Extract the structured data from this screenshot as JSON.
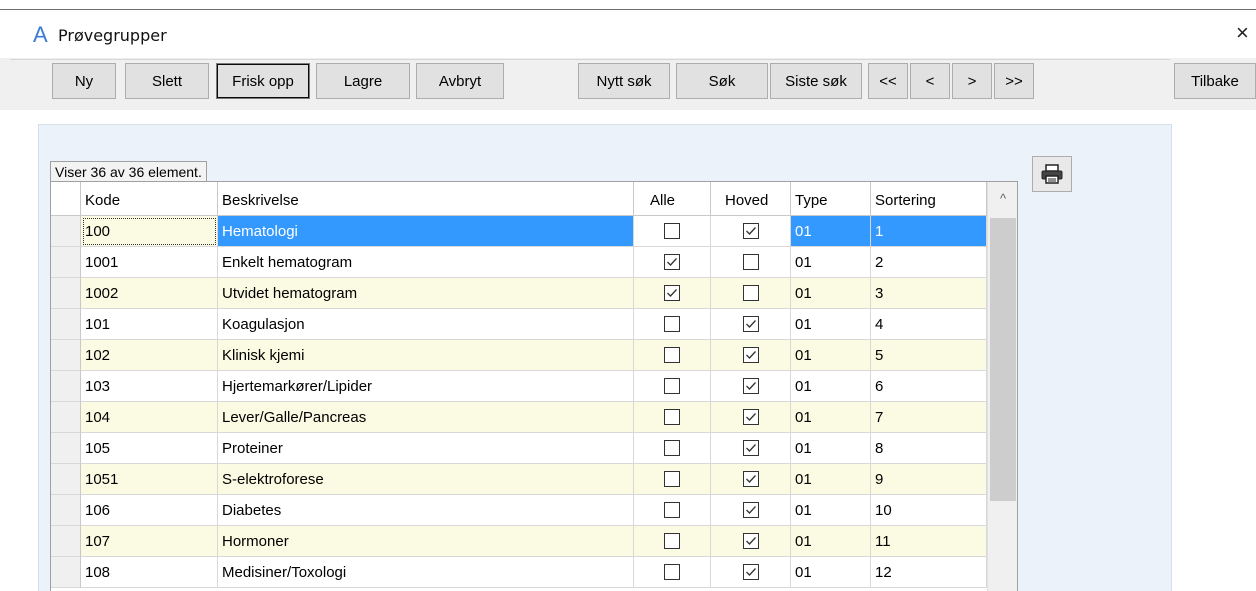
{
  "window": {
    "title": "Prøvegrupper",
    "logo": "A",
    "close": "×"
  },
  "toolbar": {
    "ny": "Ny",
    "slett": "Slett",
    "frisk_opp": "Frisk opp",
    "lagre": "Lagre",
    "avbryt": "Avbryt",
    "nytt_sok": "Nytt søk",
    "sok": "Søk",
    "siste_sok": "Siste søk",
    "first": "<<",
    "prev": "<",
    "next": ">",
    "last": ">>",
    "tilbake": "Tilbake"
  },
  "status": "Viser 36 av 36 element.",
  "icons": {
    "print": "printer-icon",
    "close": "close-icon",
    "scroll_up": "chevron-up-icon"
  },
  "colors": {
    "selection": "#3399ff",
    "alt_row": "#fbfbe3",
    "panel": "#ecf2f9",
    "logo": "#3d7bd1"
  },
  "table": {
    "columns": {
      "kode": "Kode",
      "beskrivelse": "Beskrivelse",
      "alle": "Alle",
      "hoved": "Hoved",
      "type": "Type",
      "sortering": "Sortering"
    },
    "scroll_up": "^",
    "rows": [
      {
        "kode": "100",
        "beskrivelse": "Hematologi",
        "alle": false,
        "hoved": true,
        "type": "01",
        "sortering": "1",
        "selected": true
      },
      {
        "kode": "1001",
        "beskrivelse": "Enkelt hematogram",
        "alle": true,
        "hoved": false,
        "type": "01",
        "sortering": "2"
      },
      {
        "kode": "1002",
        "beskrivelse": "Utvidet hematogram",
        "alle": true,
        "hoved": false,
        "type": "01",
        "sortering": "3"
      },
      {
        "kode": "101",
        "beskrivelse": "Koagulasjon",
        "alle": false,
        "hoved": true,
        "type": "01",
        "sortering": "4"
      },
      {
        "kode": "102",
        "beskrivelse": "Klinisk kjemi",
        "alle": false,
        "hoved": true,
        "type": "01",
        "sortering": "5"
      },
      {
        "kode": "103",
        "beskrivelse": "Hjertemarkører/Lipider",
        "alle": false,
        "hoved": true,
        "type": "01",
        "sortering": "6"
      },
      {
        "kode": "104",
        "beskrivelse": "Lever/Galle/Pancreas",
        "alle": false,
        "hoved": true,
        "type": "01",
        "sortering": "7"
      },
      {
        "kode": "105",
        "beskrivelse": "Proteiner",
        "alle": false,
        "hoved": true,
        "type": "01",
        "sortering": "8"
      },
      {
        "kode": "1051",
        "beskrivelse": "S-elektroforese",
        "alle": false,
        "hoved": true,
        "type": "01",
        "sortering": "9"
      },
      {
        "kode": "106",
        "beskrivelse": "Diabetes",
        "alle": false,
        "hoved": true,
        "type": "01",
        "sortering": "10"
      },
      {
        "kode": "107",
        "beskrivelse": "Hormoner",
        "alle": false,
        "hoved": true,
        "type": "01",
        "sortering": "11"
      },
      {
        "kode": "108",
        "beskrivelse": "Medisiner/Toxologi",
        "alle": false,
        "hoved": true,
        "type": "01",
        "sortering": "12"
      }
    ]
  }
}
